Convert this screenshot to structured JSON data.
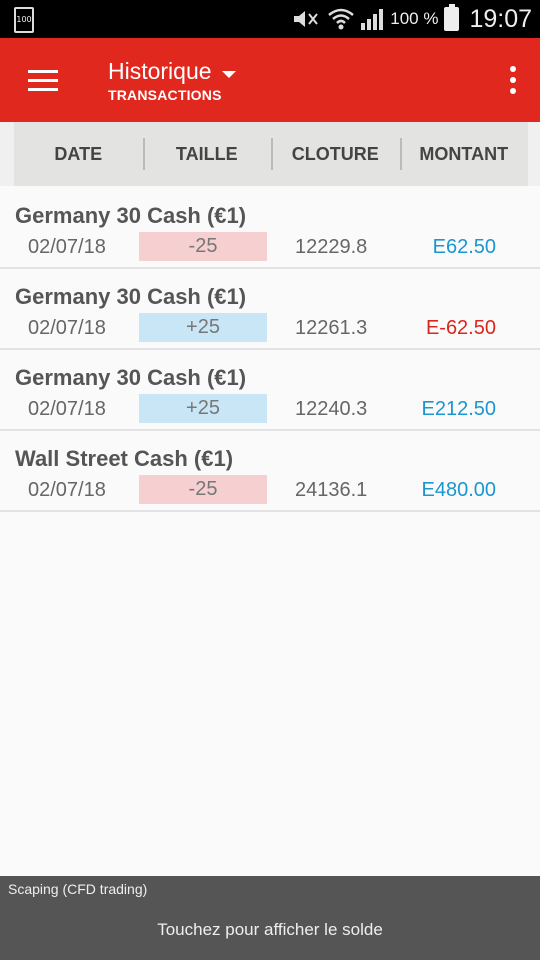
{
  "status_bar": {
    "left_icon_text": "100",
    "battery_percent": "100 %",
    "time": "19:07"
  },
  "app_bar": {
    "title": "Historique",
    "subtitle": "TRANSACTIONS"
  },
  "table": {
    "headers": [
      "DATE",
      "TAILLE",
      "CLOTURE",
      "MONTANT"
    ],
    "rows": [
      {
        "name": "Germany 30 Cash (€1)",
        "date": "02/07/18",
        "size": "-25",
        "size_type": "neg",
        "close": "12229.8",
        "amount": "E62.50",
        "amount_color": "#1a96d1"
      },
      {
        "name": "Germany 30 Cash (€1)",
        "date": "02/07/18",
        "size": "+25",
        "size_type": "pos",
        "close": "12261.3",
        "amount": "E-62.50",
        "amount_color": "#d8271c"
      },
      {
        "name": "Germany 30 Cash (€1)",
        "date": "02/07/18",
        "size": "+25",
        "size_type": "pos",
        "close": "12240.3",
        "amount": "E212.50",
        "amount_color": "#1a96d1"
      },
      {
        "name": "Wall Street Cash (€1)",
        "date": "02/07/18",
        "size": "-25",
        "size_type": "neg",
        "close": "24136.1",
        "amount": "E480.00",
        "amount_color": "#1a96d1"
      }
    ]
  },
  "footer": {
    "account_name": "Scaping (CFD trading)",
    "tap_label": "Touchez pour afficher le solde"
  },
  "colors": {
    "accent": "#e0281f",
    "positive_amount": "#1a96d1",
    "negative_amount": "#d8271c"
  }
}
